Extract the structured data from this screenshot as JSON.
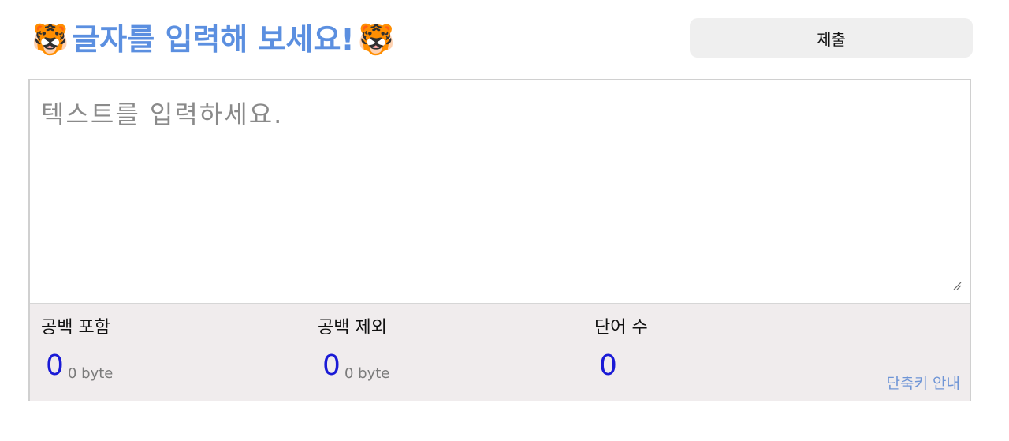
{
  "header": {
    "title": "글자를 입력해 보세요!",
    "emoji_left": "🐯",
    "emoji_right": "🐯",
    "submit_label": "제출"
  },
  "editor": {
    "placeholder": "텍스트를 입력하세요.",
    "value": ""
  },
  "stats": {
    "with_spaces": {
      "label": "공백 포함",
      "count": "0",
      "bytes": "0 byte"
    },
    "without_spaces": {
      "label": "공백 제외",
      "count": "0",
      "bytes": "0 byte"
    },
    "words": {
      "label": "단어 수",
      "count": "0"
    }
  },
  "footer": {
    "shortcut_label": "단축키 안내"
  },
  "colors": {
    "title": "#5b8fe0",
    "count": "#1a1ad6",
    "link": "#6f95d6",
    "stats_bg": "#f0eced"
  }
}
